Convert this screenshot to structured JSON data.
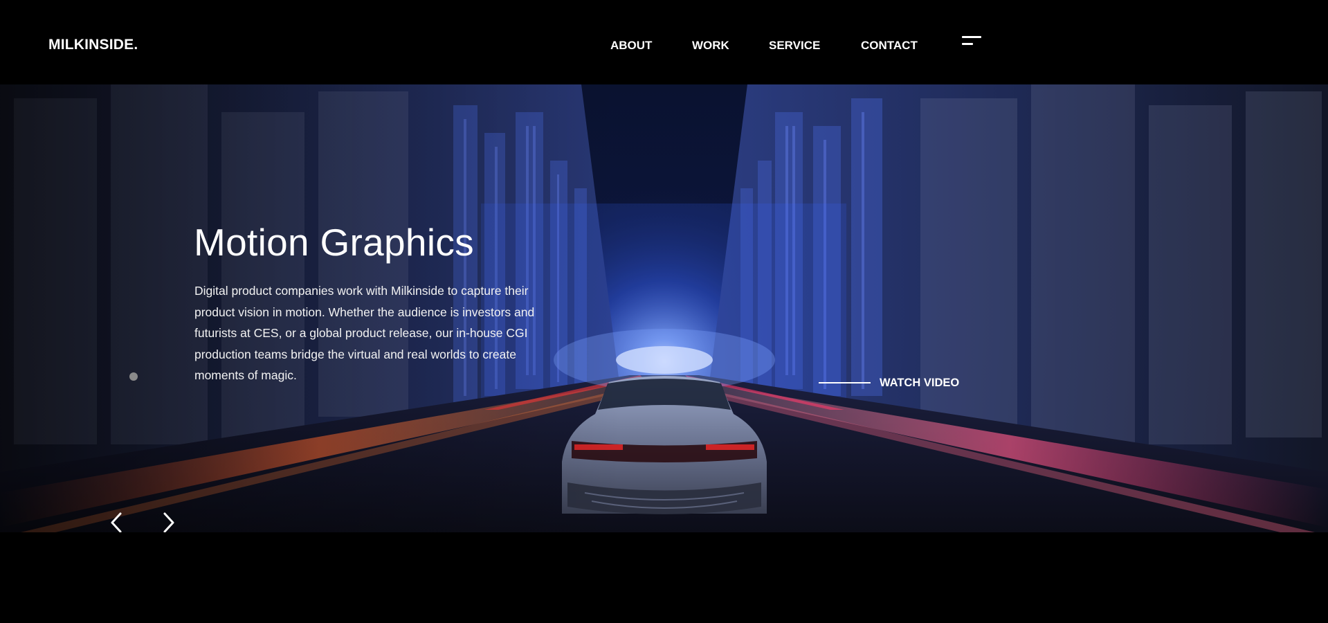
{
  "header": {
    "logo": "MILKINSIDE.",
    "nav": [
      {
        "label": "ABOUT"
      },
      {
        "label": "WORK"
      },
      {
        "label": "SERVICE"
      },
      {
        "label": "CONTACT"
      }
    ],
    "menu_icon": "hamburger-menu-icon"
  },
  "hero": {
    "title": "Motion Graphics",
    "description": "Digital product companies work with Milkinside to capture their product vision in motion. Whether the audience is investors and futurists at CES, or a global product release, our in-house CGI production teams bridge the virtual and real worlds to create moments of magic.",
    "watch_label": "WATCH VIDEO",
    "prev_icon": "chevron-left-icon",
    "next_icon": "chevron-right-icon",
    "slide_indicator": "slide-dot-icon"
  },
  "colors": {
    "background": "#000000",
    "text": "#ffffff",
    "accent_blue": "#3a6bff",
    "accent_red": "#ff4a3a"
  }
}
